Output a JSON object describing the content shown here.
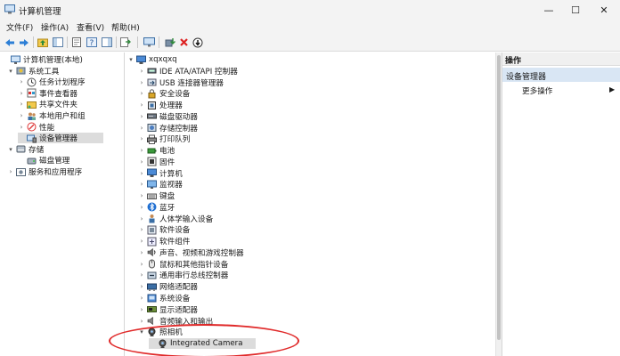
{
  "window": {
    "title": "计算机管理"
  },
  "menus": [
    "文件(F)",
    "操作(A)",
    "查看(V)",
    "帮助(H)"
  ],
  "left_tree": [
    {
      "label": "计算机管理(本地)",
      "expander": "",
      "icon": "computer-management-icon",
      "indent": 0,
      "selected": false
    },
    {
      "label": "系统工具",
      "expander": "▾",
      "icon": "system-tools-icon",
      "indent": 1,
      "selected": false
    },
    {
      "label": "任务计划程序",
      "expander": "›",
      "icon": "task-scheduler-icon",
      "indent": 2,
      "selected": false
    },
    {
      "label": "事件查看器",
      "expander": "›",
      "icon": "event-viewer-icon",
      "indent": 2,
      "selected": false
    },
    {
      "label": "共享文件夹",
      "expander": "›",
      "icon": "shared-folder-icon",
      "indent": 2,
      "selected": false
    },
    {
      "label": "本地用户和组",
      "expander": "›",
      "icon": "users-icon",
      "indent": 2,
      "selected": false
    },
    {
      "label": "性能",
      "expander": "›",
      "icon": "performance-icon",
      "indent": 2,
      "selected": false
    },
    {
      "label": "设备管理器",
      "expander": "",
      "icon": "device-manager-icon",
      "indent": 2,
      "selected": true
    },
    {
      "label": "存储",
      "expander": "▾",
      "icon": "storage-icon",
      "indent": 1,
      "selected": false
    },
    {
      "label": "磁盘管理",
      "expander": "",
      "icon": "disk-management-icon",
      "indent": 2,
      "selected": false
    },
    {
      "label": "服务和应用程序",
      "expander": "›",
      "icon": "services-icon",
      "indent": 1,
      "selected": false
    }
  ],
  "device_tree": {
    "root": "xqxqxq",
    "items": [
      {
        "label": "IDE ATA/ATAPI 控制器",
        "icon": "ide-controller-icon",
        "expander": "›"
      },
      {
        "label": "USB 连接器管理器",
        "icon": "usb-icon",
        "expander": "›"
      },
      {
        "label": "安全设备",
        "icon": "security-device-icon",
        "expander": "›"
      },
      {
        "label": "处理器",
        "icon": "processor-icon",
        "expander": "›"
      },
      {
        "label": "磁盘驱动器",
        "icon": "disk-drive-icon",
        "expander": "›"
      },
      {
        "label": "存储控制器",
        "icon": "storage-controller-icon",
        "expander": "›"
      },
      {
        "label": "打印队列",
        "icon": "printer-icon",
        "expander": "›"
      },
      {
        "label": "电池",
        "icon": "battery-icon",
        "expander": "›"
      },
      {
        "label": "固件",
        "icon": "firmware-icon",
        "expander": "›"
      },
      {
        "label": "计算机",
        "icon": "computer-icon",
        "expander": "›"
      },
      {
        "label": "监视器",
        "icon": "monitor-icon",
        "expander": "›"
      },
      {
        "label": "键盘",
        "icon": "keyboard-icon",
        "expander": "›"
      },
      {
        "label": "蓝牙",
        "icon": "bluetooth-icon",
        "expander": "›"
      },
      {
        "label": "人体学输入设备",
        "icon": "hid-icon",
        "expander": "›"
      },
      {
        "label": "软件设备",
        "icon": "software-device-icon",
        "expander": "›"
      },
      {
        "label": "软件组件",
        "icon": "software-component-icon",
        "expander": "›"
      },
      {
        "label": "声音、视频和游戏控制器",
        "icon": "sound-icon",
        "expander": "›"
      },
      {
        "label": "鼠标和其他指针设备",
        "icon": "mouse-icon",
        "expander": "›"
      },
      {
        "label": "通用串行总线控制器",
        "icon": "usb-controller-icon",
        "expander": "›"
      },
      {
        "label": "网络适配器",
        "icon": "network-adapter-icon",
        "expander": "›"
      },
      {
        "label": "系统设备",
        "icon": "system-device-icon",
        "expander": "›"
      },
      {
        "label": "显示适配器",
        "icon": "display-adapter-icon",
        "expander": "›"
      },
      {
        "label": "音频输入和输出",
        "icon": "audio-io-icon",
        "expander": "›"
      },
      {
        "label": "照相机",
        "icon": "camera-icon",
        "expander": "▾"
      }
    ],
    "child": {
      "label": "Integrated Camera",
      "icon": "webcam-icon"
    }
  },
  "actions": {
    "header": "操作",
    "section": "设备管理器",
    "more": "更多操作"
  },
  "colors": {
    "annotation": "#e02a2a",
    "selection": "#dcdcdc",
    "actions_section": "#d9e6f4"
  }
}
